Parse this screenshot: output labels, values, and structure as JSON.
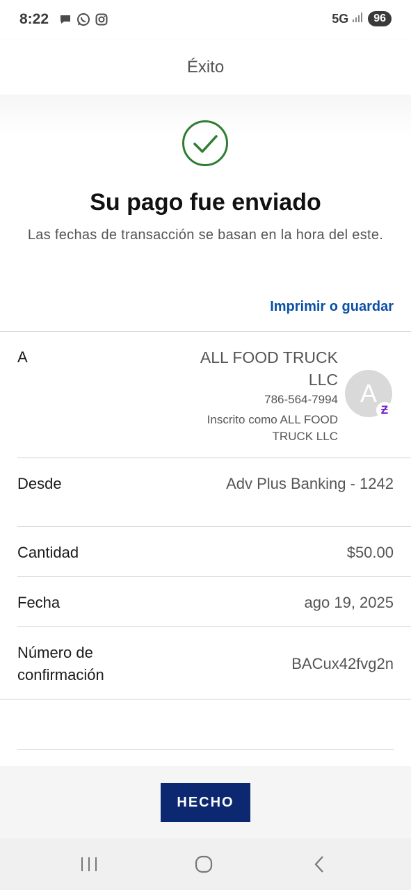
{
  "status_bar": {
    "time": "8:22",
    "network": "5G",
    "battery": "96",
    "icons": [
      "message-icon",
      "whatsapp-icon",
      "instagram-icon",
      "signal-icon"
    ]
  },
  "header": {
    "title": "Éxito"
  },
  "success": {
    "title": "Su pago fue enviado",
    "subtitle": "Las fechas de transacción se basan en la hora del este.",
    "print_link": "Imprimir o guardar",
    "check_color": "#2e7d32"
  },
  "details": {
    "to": {
      "label": "A",
      "name": "ALL FOOD TRUCK LLC",
      "phone": "786-564-7994",
      "enrolled": "Inscrito como ALL FOOD TRUCK LLC",
      "avatar_letter": "A",
      "badge": "Ƶ"
    },
    "from": {
      "label": "Desde",
      "value": "Adv Plus Banking - 1242"
    },
    "amount": {
      "label": "Cantidad",
      "value": "$50.00"
    },
    "date": {
      "label": "Fecha",
      "value": "ago 19, 2025"
    },
    "confirmation": {
      "label": "Número de confirmación",
      "value": "BACux42fvg2n"
    }
  },
  "actions": {
    "done_label": "HECHO",
    "done_color": "#0b2870"
  },
  "colors": {
    "link": "#0a4fa6",
    "zelle": "#6d1ed4"
  }
}
